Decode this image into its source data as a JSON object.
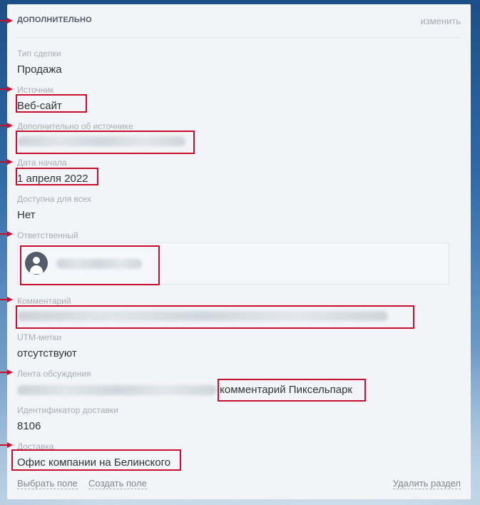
{
  "section": {
    "title": "ДОПОЛНИТЕЛЬНО",
    "edit": "изменить"
  },
  "fields": {
    "deal_type": {
      "label": "Тип сделки",
      "value": "Продажа"
    },
    "source": {
      "label": "Источник",
      "value": "Веб-сайт"
    },
    "source_info": {
      "label": "Дополнительно об источнике"
    },
    "start_date": {
      "label": "Дата начала",
      "value": "1 апреля 2022"
    },
    "available_all": {
      "label": "Доступна для всех",
      "value": "Нет"
    },
    "responsible": {
      "label": "Ответственный"
    },
    "comment": {
      "label": "Комментарий"
    },
    "utm": {
      "label": "UTM-метки",
      "value": "отсутствуют"
    },
    "feed": {
      "label": "Лента обсуждения",
      "value_suffix": "комментарий Пиксельпарк"
    },
    "delivery_id": {
      "label": "Идентификатор доставки",
      "value": "8106"
    },
    "delivery": {
      "label": "Доставка",
      "value": "Офис компании на Белинского"
    }
  },
  "footer": {
    "choose_field": "Выбрать поле",
    "create_field": "Создать поле",
    "delete_section": "Удалить раздел"
  },
  "colors": {
    "annotation": "#c8102e",
    "label": "#a8adb4",
    "text": "#333333"
  }
}
